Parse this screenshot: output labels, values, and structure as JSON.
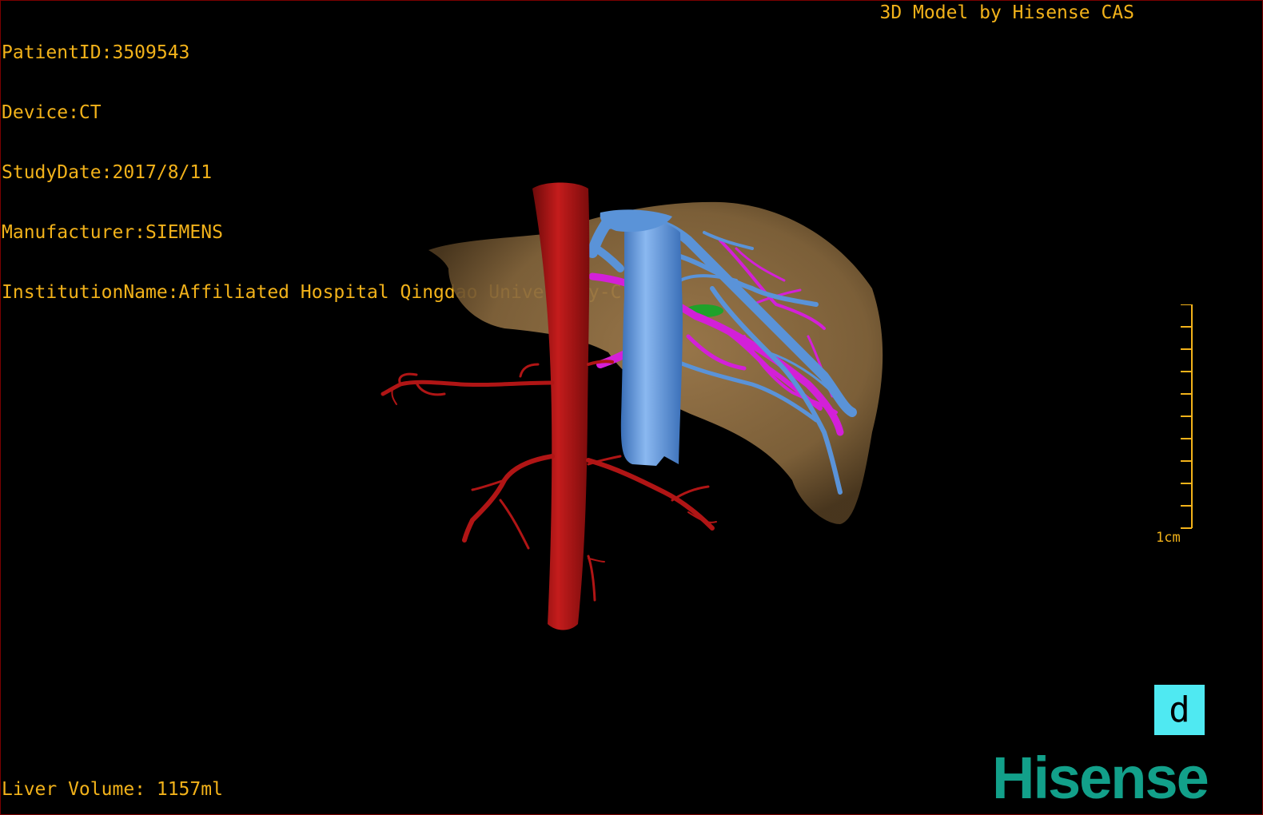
{
  "patient_info": {
    "patient_id": "PatientID:3509543",
    "device": "Device:CT",
    "study_date": "StudyDate:2017/8/11",
    "manufacturer": "Manufacturer:SIEMENS",
    "institution": "InstitutionName:Affiliated Hospital Qingdao University-C"
  },
  "credit": "3D Model by Hisense CAS",
  "liver_volume": "Liver Volume: 1157ml",
  "scale": {
    "label": "1cm"
  },
  "view_button": {
    "label": "d"
  },
  "brand": "Hisense",
  "colors": {
    "overlay_text": "#f2b21a",
    "liver": "#8a6a3e",
    "aorta": "#b01515",
    "portal_vein": "#5a93d8",
    "hepatic_vessels": "#d320d8",
    "gallbladder": "#1fa22a",
    "view_button": "#4fe9f2",
    "brand": "#12a08a"
  }
}
